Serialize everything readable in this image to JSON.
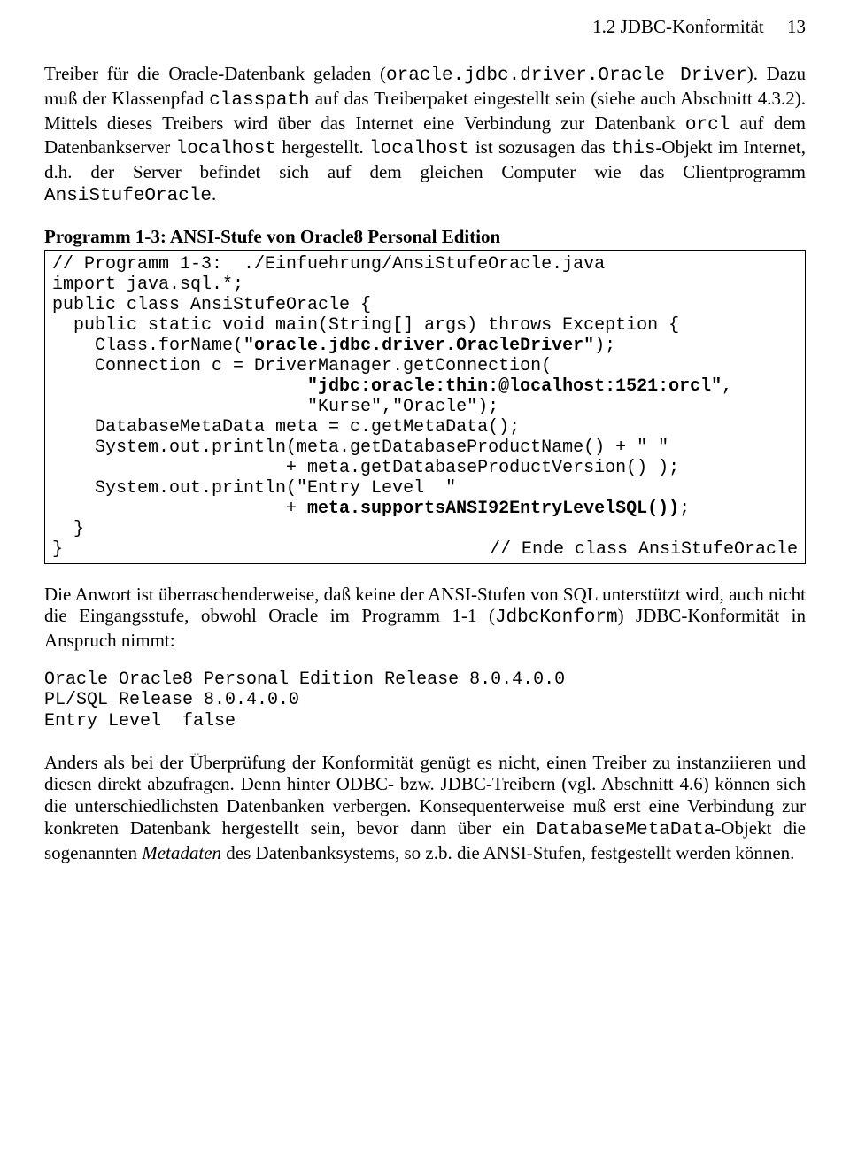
{
  "header": {
    "section": "1.2 JDBC-Konformität",
    "page_no": "13"
  },
  "para1": {
    "t1": "Treiber für die Oracle-Datenbank geladen (",
    "c1": "oracle.jdbc.driver.Oracle Driver",
    "t2": "). Dazu muß der Klassenpfad ",
    "c2": "classpath",
    "t3": " auf das Treiberpaket einge­stellt sein (siehe auch Abschnitt 4.3.2). Mittels dieses Treibers wird über das Internet eine Verbindung zur Datenbank ",
    "c3": "orcl",
    "t4": " auf dem Datenbankserver ",
    "c4": "localhost",
    "t5": " hergestellt. ",
    "c5": "localhost",
    "t6": " ist sozusagen das ",
    "c6": "this",
    "t7": "-Objekt  im Inter­net, d.h. der Server befindet sich auf dem gleichen Computer wie das Client­programm ",
    "c7": "AnsiStufeOracle",
    "t8": "."
  },
  "listing_caption": "Programm 1-3: ANSI-Stufe von Oracle8 Personal Edition",
  "code": {
    "l01": "// Programm 1-3:  ./Einfuehrung/AnsiStufeOracle.java",
    "l02": "import java.sql.*;",
    "l03": "public class AnsiStufeOracle {",
    "l04": "  public static void main(String[] args) throws Exception {",
    "l05a": "    Class.forName(",
    "l05b": "\"oracle.jdbc.driver.OracleDriver\"",
    "l05c": ");",
    "l06": "    Connection c = DriverManager.getConnection(",
    "l07a": "                        ",
    "l07b": "\"jdbc:oracle:thin:@localhost:1521:orcl\"",
    "l07c": ",",
    "l08": "                        \"Kurse\",\"Oracle\");",
    "l09": "    DatabaseMetaData meta = c.getMetaData();",
    "l10": "    System.out.println(meta.getDatabaseProductName() + \" \"",
    "l11": "                      + meta.getDatabaseProductVersion() );",
    "l12": "    System.out.println(\"Entry Level  \"",
    "l13a": "                      + ",
    "l13b": "meta.supportsANSI92EntryLevelSQL())",
    "l13c": ";",
    "l14": "  }",
    "l15a": "}",
    "l15b": "// Ende class AnsiStufeOracle"
  },
  "para2": {
    "t1": "Die Anwort ist überraschenderweise, daß keine der ANSI-Stufen von SQL unterstützt wird, auch nicht die Eingangsstufe, obwohl Oracle im Programm 1-1 (",
    "c1": "JdbcKonform",
    "t2": ") JDBC-Konformität in Anspruch nimmt:"
  },
  "output": "Oracle Oracle8 Personal Edition Release 8.0.4.0.0\nPL/SQL Release 8.0.4.0.0\nEntry Level  false",
  "para3": {
    "t1": "Anders als bei der Überprüfung der Konformität genügt es nicht, einen Treiber zu instanziieren und diesen direkt abzufragen. Denn hinter ODBC- bzw. JDBC-Treibern (vgl. Abschnitt 4.6) können sich die unterschiedlichsten Datenbanken verbergen. Konsequenterweise muß erst eine Verbindung zur konkreten Daten­bank hergestellt sein, bevor dann über ein ",
    "c1": "DatabaseMetaData",
    "t2": "-Objekt die sogenannten ",
    "i1": "Metadaten",
    "t3": " des Datenbanksystems, so z.b. die ANSI-Stufen, fest­gestellt werden können."
  }
}
